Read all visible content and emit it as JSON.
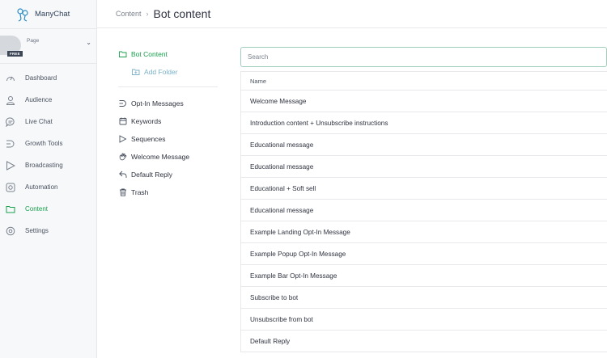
{
  "app": {
    "name": "ManyChat",
    "page_label": "Page",
    "free_badge": "FREE"
  },
  "sidebar": {
    "items": [
      {
        "label": "Dashboard",
        "icon": "dashboard-icon"
      },
      {
        "label": "Audience",
        "icon": "user-icon"
      },
      {
        "label": "Live Chat",
        "icon": "chat-bubble-icon"
      },
      {
        "label": "Growth Tools",
        "icon": "growth-icon"
      },
      {
        "label": "Broadcasting",
        "icon": "send-icon"
      },
      {
        "label": "Automation",
        "icon": "gear-icon"
      },
      {
        "label": "Content",
        "icon": "folder-icon",
        "active": true
      },
      {
        "label": "Settings",
        "icon": "settings-icon"
      }
    ]
  },
  "header": {
    "breadcrumb": "Content",
    "separator": "›",
    "title": "Bot content"
  },
  "folders": {
    "root": "Bot Content",
    "add_folder": "Add Folder",
    "items": [
      {
        "label": "Opt-In Messages",
        "icon": "optin-icon"
      },
      {
        "label": "Keywords",
        "icon": "keywords-icon"
      },
      {
        "label": "Sequences",
        "icon": "sequences-icon"
      },
      {
        "label": "Welcome Message",
        "icon": "wave-icon"
      },
      {
        "label": "Default Reply",
        "icon": "reply-icon"
      },
      {
        "label": "Trash",
        "icon": "trash-icon"
      }
    ]
  },
  "search": {
    "placeholder": "Search"
  },
  "table": {
    "header": "Name",
    "rows": [
      "Welcome Message",
      "Introduction content + Unsubscribe instructions",
      "Educational message",
      "Educational message",
      "Educational + Soft sell",
      "Educational message",
      "Example Landing Opt-In Message",
      "Example Popup Opt-In Message",
      "Example Bar Opt-In Message",
      "Subscribe to bot",
      "Unsubscribe from bot",
      "Default Reply"
    ]
  },
  "colors": {
    "accent": "#19a04d",
    "sidebar_bg": "#f7f8fa",
    "border": "#e6e8ec",
    "search_border": "#9fcfba"
  }
}
